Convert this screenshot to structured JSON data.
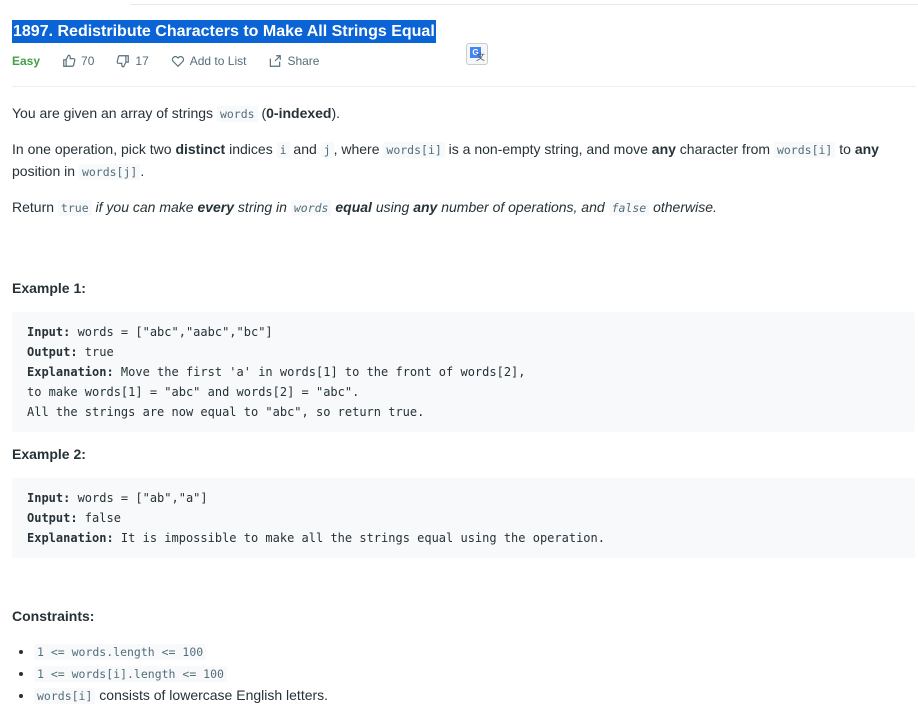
{
  "problem": {
    "title": "1897. Redistribute Characters to Make All Strings Equal",
    "difficulty": "Easy",
    "likes": "70",
    "dislikes": "17",
    "add_to_list": "Add to List",
    "share": "Share"
  },
  "icons": [
    "thumbs-up-icon",
    "thumbs-down-icon",
    "heart-icon",
    "share-icon",
    "translate-icon"
  ],
  "colors": {
    "difficulty_easy": "#43a047",
    "selection": "#0a64d6"
  },
  "description": {
    "p1": {
      "a": "You are given an array of strings ",
      "code": "words",
      "b": " (",
      "bold": "0-indexed",
      "c": ")."
    },
    "p2": {
      "a": "In one operation, pick two ",
      "b1": "distinct",
      "b": " indices ",
      "c1": "i",
      "c": " and ",
      "c2": "j",
      "d": ", where ",
      "c3": "words[i]",
      "e": " is a non-empty string, and move ",
      "b2": "any",
      "f": " character from ",
      "c4": "words[i]",
      "g": " to ",
      "b3": "any",
      "h": " position in ",
      "c5": "words[j]",
      "i": "."
    },
    "p3": {
      "a": "Return ",
      "c1": "true",
      "b": " if you can make ",
      "b1": "every",
      "c": " string in ",
      "c2": "words",
      "b2": "equal",
      "d": " using ",
      "b3": "any",
      "e": " number of operations, and ",
      "c3": "false",
      "f": " otherwise."
    }
  },
  "examples": [
    {
      "heading": "Example 1:",
      "input_label": "Input:",
      "input": " words = [\"abc\",\"aabc\",\"bc\"]",
      "output_label": "Output:",
      "output": " true",
      "explanation_label": "Explanation:",
      "explanation": " Move the first 'a' in words[1] to the front of words[2],\nto make words[1] = \"abc\" and words[2] = \"abc\".\nAll the strings are now equal to \"abc\", so return true."
    },
    {
      "heading": "Example 2:",
      "input_label": "Input:",
      "input": " words = [\"ab\",\"a\"]",
      "output_label": "Output:",
      "output": " false",
      "explanation_label": "Explanation:",
      "explanation": " It is impossible to make all the strings equal using the operation."
    }
  ],
  "constraints": {
    "heading": "Constraints:",
    "items": [
      {
        "code": "1 <= words.length <= 100",
        "text": ""
      },
      {
        "code": "1 <= words[i].length <= 100",
        "text": ""
      },
      {
        "code": "words[i]",
        "text": " consists of lowercase English letters."
      }
    ]
  }
}
